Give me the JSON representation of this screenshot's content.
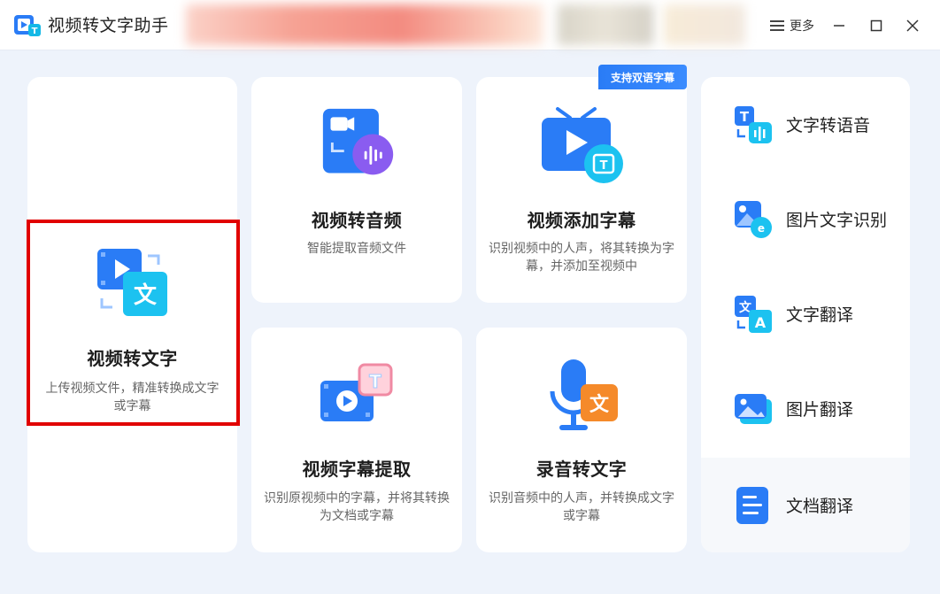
{
  "app": {
    "title": "视频转文字助手",
    "more_label": "更多"
  },
  "main_cards": [
    {
      "title": "视频转文字",
      "desc": "上传视频文件，精准转换成文字或字幕"
    },
    {
      "title": "视频转音频",
      "desc": "智能提取音频文件"
    },
    {
      "title": "视频添加字幕",
      "desc": "识别视频中的人声，将其转换为字幕，并添加至视频中",
      "badge": "支持双语字幕"
    },
    {
      "title": "视频字幕提取",
      "desc": "识别原视频中的字幕，并将其转换为文档或字幕"
    },
    {
      "title": "录音转文字",
      "desc": "识别音频中的人声，并转换成文字或字幕"
    }
  ],
  "side_tools": [
    {
      "label": "文字转语音",
      "icon": "text-to-speech-icon"
    },
    {
      "label": "图片文字识别",
      "icon": "image-ocr-icon"
    },
    {
      "label": "文字翻译",
      "icon": "text-translate-icon"
    },
    {
      "label": "图片翻译",
      "icon": "image-translate-icon"
    },
    {
      "label": "文档翻译",
      "icon": "document-translate-icon"
    }
  ],
  "colors": {
    "accent": "#2a7cf6",
    "highlight": "#e10000",
    "background": "#eef3fb"
  }
}
